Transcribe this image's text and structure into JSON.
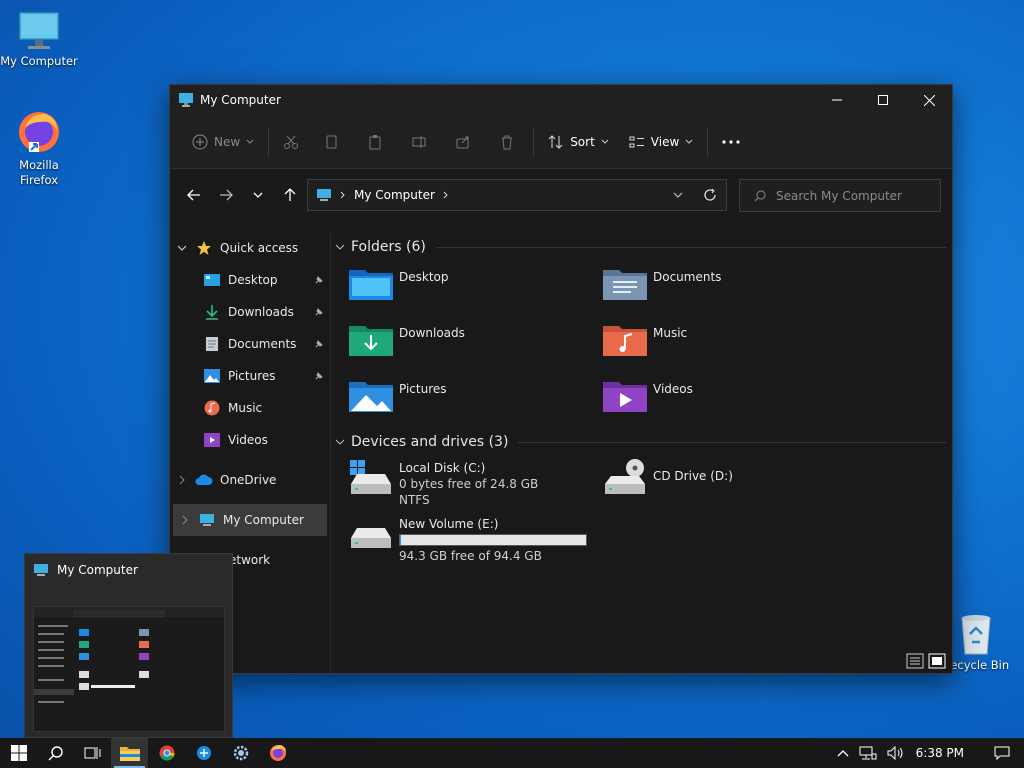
{
  "desktop": {
    "icons": [
      {
        "label": "My Computer"
      },
      {
        "label": "Mozilla Firefox"
      },
      {
        "label": "Recycle Bin"
      }
    ]
  },
  "window": {
    "title": "My Computer",
    "toolbar": {
      "new_label": "New",
      "sort_label": "Sort",
      "view_label": "View"
    },
    "address": {
      "crumb": "My Computer"
    },
    "search": {
      "placeholder": "Search My Computer"
    },
    "nav": {
      "quick_access": "Quick access",
      "items": [
        {
          "label": "Desktop"
        },
        {
          "label": "Downloads"
        },
        {
          "label": "Documents"
        },
        {
          "label": "Pictures"
        },
        {
          "label": "Music"
        },
        {
          "label": "Videos"
        }
      ],
      "onedrive": "OneDrive",
      "my_computer": "My Computer",
      "network": "Network"
    },
    "folders_header": "Folders (6)",
    "folders": [
      {
        "label": "Desktop",
        "color": "#1e88e5"
      },
      {
        "label": "Documents",
        "color": "#7b95b5"
      },
      {
        "label": "Downloads",
        "color": "#1fa87a"
      },
      {
        "label": "Music",
        "color": "#e86a4b"
      },
      {
        "label": "Pictures",
        "color": "#2f8fe0"
      },
      {
        "label": "Videos",
        "color": "#8e44c4"
      }
    ],
    "drives_header": "Devices and drives (3)",
    "drives": [
      {
        "name": "Local Disk (C:)",
        "free": "0 bytes free of 24.8 GB",
        "fs": "NTFS"
      },
      {
        "name": "CD Drive (D:)"
      },
      {
        "name": "New Volume (E:)",
        "free": "94.3 GB free of 94.4 GB",
        "used_fraction": 0.001
      }
    ]
  },
  "thumbnail": {
    "title": "My Computer"
  },
  "taskbar": {
    "clock": "6:38 PM"
  },
  "colors": {
    "accent": "#0078d4",
    "desktop": "#1177d4"
  }
}
